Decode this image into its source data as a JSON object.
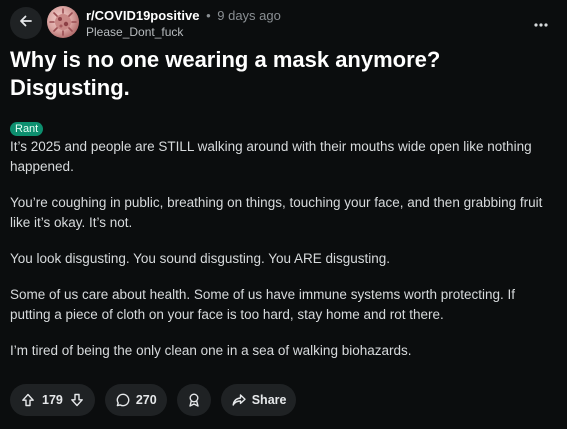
{
  "post": {
    "subreddit": "r/COVID19positive",
    "separator": "•",
    "time_ago": "9 days ago",
    "author": "Please_Dont_fuck",
    "title": "Why is no one wearing a mask anymore? Disgusting.",
    "flair": "Rant",
    "body": [
      "It’s 2025 and people are STILL walking around with their mouths wide open like nothing happened.",
      "You’re coughing in public, breathing on things, touching your face, and then grabbing fruit like it’s okay. It’s not.",
      "You look disgusting. You sound disgusting. You ARE disgusting.",
      "Some of us care about health. Some of us have immune systems worth protecting. If putting a piece of cloth on your face is too hard, stay home and rot there.",
      "I’m tired of being the only clean one in a sea of walking biohazards."
    ]
  },
  "actions": {
    "upvotes": "179",
    "comments": "270",
    "share_label": "Share"
  },
  "icons": {
    "back": "arrow-left-icon",
    "more": "more-dots-icon",
    "upvote": "arrow-up-icon",
    "downvote": "arrow-down-icon",
    "comment": "comment-bubble-icon",
    "award": "award-icon",
    "share": "share-arrow-icon"
  },
  "colors": {
    "background": "#0b0d0e",
    "flair": "#0d8f6f",
    "pill": "#1f2224"
  }
}
